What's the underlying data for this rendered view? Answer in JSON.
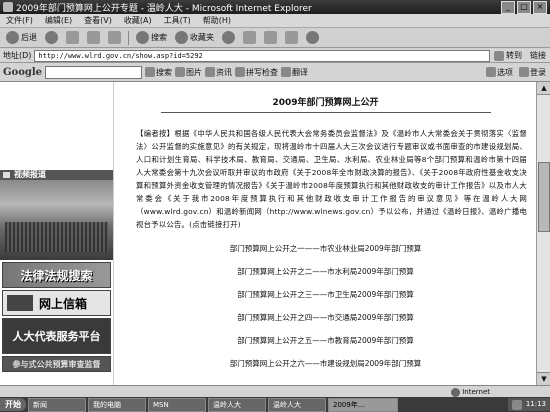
{
  "window": {
    "title": "2009年部门预算网上公开专题 - 温岭人大 - Microsoft Internet Explorer"
  },
  "menu": [
    "文件(F)",
    "编辑(E)",
    "查看(V)",
    "收藏(A)",
    "工具(T)",
    "帮助(H)"
  ],
  "toolbar": {
    "back_label": "后退",
    "search_label": "搜索",
    "favorites_label": "收藏夹"
  },
  "address": {
    "label": "地址(D)",
    "url": "http://www.wlrd.gov.cn/show.asp?id=5292",
    "go_label": "转到",
    "links_label": "链接"
  },
  "google": {
    "logo": "Google",
    "search_label": "搜索",
    "items": [
      "图片",
      "资讯",
      "拼写检查",
      "翻译"
    ],
    "options_label": "选项",
    "signin_label": "登录"
  },
  "sidebar": {
    "section_title": "视频报道",
    "banner_law": "法律法规搜索",
    "banner_letter": "网上信箱",
    "banner_service": "人大代表服务平台",
    "banner_bottom": "参与式公共预算审查监督"
  },
  "article": {
    "title": "2009年部门预算网上公开",
    "intro": "【编者按】根据《中华人民共和国各级人民代表大会常务委员会监督法》及《温岭市人大常委会关于贯彻落实〈监督法〉公开监督的实施意见》的有关规定，现将温岭市十四届人大三次会议进行专题审议或书面审查的市建设规划局、人口和计划生育局、科学技术局、教育局、交通局、卫生局、水利局、农业林业局等8个部门预算和温岭市第十四届人大常委会第十九次会议听取并审议的市政府《关于2008年全市财政决算的报告》、《关于2008年政府性基金收支决算和预算外资金收支管理的情况报告》《关于温岭市2008年度预算执行和其他财政收支的审计工作报告》以及市人大常委会《关于我市2008年度预算执行和其他财政收支审计工作报告的审议意见》等在温岭人大网（www.wlrd.gov.cn）和温岭新闻网（http://www.wlnews.gov.cn）予以公布，并通过《温岭日报》、温岭广播电视台予以公告。(点击链接打开)",
    "links": [
      "部门预算网上公开之一——市农业林业局2009年部门预算",
      "部门预算网上公开之二——市水利局2009年部门预算",
      "部门预算网上公开之三——市卫生局2009年部门预算",
      "部门预算网上公开之四——市交通局2009年部门预算",
      "部门预算网上公开之五——市教育局2009年部门预算",
      "部门预算网上公开之六——市建设规划局2009年部门预算"
    ]
  },
  "status": {
    "zone": "Internet"
  },
  "taskbar": {
    "start": "开始",
    "items": [
      "新闻",
      "我的电脑",
      "MSN",
      "温岭人大",
      "温岭人大"
    ],
    "active": "2009年...",
    "clock": "11:13"
  }
}
